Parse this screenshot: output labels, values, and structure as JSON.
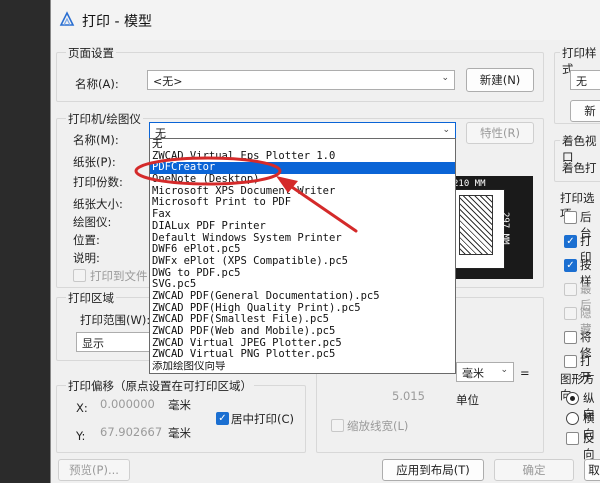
{
  "window": {
    "title": "打印 - 模型"
  },
  "page_setup": {
    "group_label": "页面设置",
    "name_label": "名称(A):",
    "name_value": "<无>",
    "add_button": "新建(N)"
  },
  "printer": {
    "group_label": "打印机/绘图仪",
    "name_label": "名称(M):",
    "name_value": "无",
    "properties_button": "特性(R)",
    "paper_label": "纸张(P):",
    "copies_label": "打印份数:",
    "paper_size_label": "纸张大小:",
    "plotter_label": "绘图仪:",
    "location_label": "位置:",
    "description_label": "说明:",
    "print_to_file_label": "打印到文件"
  },
  "printer_dropdown": {
    "items": [
      "无",
      "ZWCAD Virtual Eps Plotter 1.0",
      "PDFCreator",
      "OneNote (Desktop)",
      "Microsoft XPS Document Writer",
      "Microsoft Print to PDF",
      "Fax",
      "DIALux PDF Printer",
      "Default Windows System Printer",
      "DWF6 ePlot.pc5",
      "DWFx ePlot (XPS Compatible).pc5",
      "DWG to PDF.pc5",
      "SVG.pc5",
      "ZWCAD PDF(General Documentation).pc5",
      "ZWCAD PDF(High Quality Print).pc5",
      "ZWCAD PDF(Smallest File).pc5",
      "ZWCAD PDF(Web and Mobile).pc5",
      "ZWCAD Virtual JPEG Plotter.pc5",
      "ZWCAD Virtual PNG Plotter.pc5",
      "添加绘图仪向导"
    ],
    "selected_index": 2
  },
  "paper_preview": {
    "width_label": "210 MM",
    "height_label": "297 MM"
  },
  "print_area": {
    "group_label": "打印区域",
    "range_label": "打印范围(W):",
    "range_value": "显示"
  },
  "print_offset": {
    "group_label": "打印偏移（原点设置在可打印区域）",
    "x_label": "X:",
    "x_value": "0.000000",
    "x_unit": "毫米",
    "y_label": "Y:",
    "y_value": "67.902667",
    "y_unit": "毫米",
    "center_label": "居中打印(C)"
  },
  "scale": {
    "unit_value": "毫米",
    "equals": "=",
    "value": "5.015",
    "unit_label": "单位",
    "scale_lineweight_label": "缩放线宽(L)"
  },
  "right_panel": {
    "style_group_label": "打印样式",
    "style_value": "无",
    "new_button": "新",
    "shade_group_label": "着色视口",
    "shade_label": "着色打",
    "options_group_label": "打印选项",
    "options": [
      {
        "label": "后台",
        "checked": false,
        "disabled": false
      },
      {
        "label": "打印",
        "checked": true,
        "disabled": false
      },
      {
        "label": "按样",
        "checked": true,
        "disabled": false
      },
      {
        "label": "最后",
        "checked": false,
        "disabled": true
      },
      {
        "label": "隐藏",
        "checked": false,
        "disabled": true
      },
      {
        "label": "将修",
        "checked": false,
        "disabled": false
      },
      {
        "label": "打开",
        "checked": false,
        "disabled": false
      }
    ],
    "orientation_group_label": "图形方向",
    "orientations": [
      {
        "label": "纵向",
        "selected": true
      },
      {
        "label": "横向",
        "selected": false
      }
    ],
    "reverse_label": "反向"
  },
  "footer": {
    "preview_button": "预览(P)...",
    "apply_button": "应用到布局(T)",
    "ok_button": "确定",
    "cancel_button": "取"
  },
  "colors": {
    "selection": "#0a64d6",
    "annotation": "#d42a2a",
    "checkbox": "#1b6fd1"
  }
}
